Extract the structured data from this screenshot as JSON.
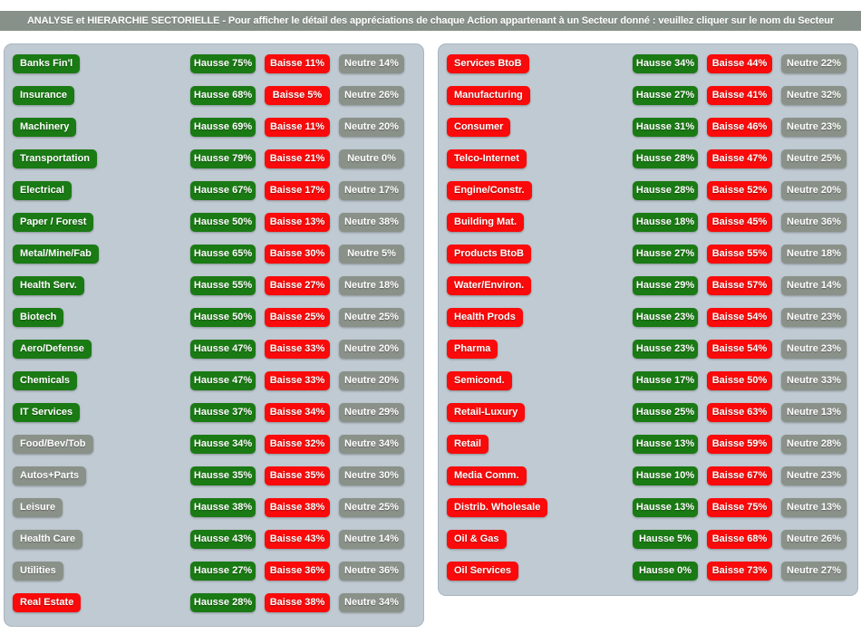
{
  "header": {
    "title": "ANALYSE et HIERARCHIE SECTORIELLE - Pour afficher le détail des appréciations de chaque Action appartenant à un Secteur donné : veuillez cliquer sur le nom du Secteur"
  },
  "legend": {
    "hausse_word": "Hausse",
    "baisse_word": "Baisse",
    "neutre_word": "Neutre"
  },
  "colors": {
    "green": "#1a7a14",
    "red": "#fa0a0a",
    "grey": "#8a9189",
    "panel_bg": "#c0cad2",
    "header_bg": "#879189",
    "page_bg": "#ffffff"
  },
  "chart_data": {
    "type": "table",
    "title": "ANALYSE et HIERARCHIE SECTORIELLE",
    "columns": [
      "Secteur",
      "Hausse",
      "Baisse",
      "Neutre"
    ],
    "units": "%",
    "left_column": [
      {
        "sector": "Banks Fin'l",
        "tone": "green",
        "hausse": 75,
        "baisse": 11,
        "neutre": 14
      },
      {
        "sector": "Insurance",
        "tone": "green",
        "hausse": 68,
        "baisse": 5,
        "neutre": 26
      },
      {
        "sector": "Machinery",
        "tone": "green",
        "hausse": 69,
        "baisse": 11,
        "neutre": 20
      },
      {
        "sector": "Transportation",
        "tone": "green",
        "hausse": 79,
        "baisse": 21,
        "neutre": 0
      },
      {
        "sector": "Electrical",
        "tone": "green",
        "hausse": 67,
        "baisse": 17,
        "neutre": 17
      },
      {
        "sector": "Paper / Forest",
        "tone": "green",
        "hausse": 50,
        "baisse": 13,
        "neutre": 38
      },
      {
        "sector": "Metal/Mine/Fab",
        "tone": "green",
        "hausse": 65,
        "baisse": 30,
        "neutre": 5
      },
      {
        "sector": "Health Serv.",
        "tone": "green",
        "hausse": 55,
        "baisse": 27,
        "neutre": 18
      },
      {
        "sector": "Biotech",
        "tone": "green",
        "hausse": 50,
        "baisse": 25,
        "neutre": 25
      },
      {
        "sector": "Aero/Defense",
        "tone": "green",
        "hausse": 47,
        "baisse": 33,
        "neutre": 20
      },
      {
        "sector": "Chemicals",
        "tone": "green",
        "hausse": 47,
        "baisse": 33,
        "neutre": 20
      },
      {
        "sector": "IT Services",
        "tone": "green",
        "hausse": 37,
        "baisse": 34,
        "neutre": 29
      },
      {
        "sector": "Food/Bev/Tob",
        "tone": "grey",
        "hausse": 34,
        "baisse": 32,
        "neutre": 34
      },
      {
        "sector": "Autos+Parts",
        "tone": "grey",
        "hausse": 35,
        "baisse": 35,
        "neutre": 30
      },
      {
        "sector": "Leisure",
        "tone": "grey",
        "hausse": 38,
        "baisse": 38,
        "neutre": 25
      },
      {
        "sector": "Health Care",
        "tone": "grey",
        "hausse": 43,
        "baisse": 43,
        "neutre": 14
      },
      {
        "sector": "Utilities",
        "tone": "grey",
        "hausse": 27,
        "baisse": 36,
        "neutre": 36
      },
      {
        "sector": "Real Estate",
        "tone": "red",
        "hausse": 28,
        "baisse": 38,
        "neutre": 34
      }
    ],
    "right_column": [
      {
        "sector": "Services BtoB",
        "tone": "red",
        "hausse": 34,
        "baisse": 44,
        "neutre": 22
      },
      {
        "sector": "Manufacturing",
        "tone": "red",
        "hausse": 27,
        "baisse": 41,
        "neutre": 32
      },
      {
        "sector": "Consumer",
        "tone": "red",
        "hausse": 31,
        "baisse": 46,
        "neutre": 23
      },
      {
        "sector": "Telco-Internet",
        "tone": "red",
        "hausse": 28,
        "baisse": 47,
        "neutre": 25
      },
      {
        "sector": "Engine/Constr.",
        "tone": "red",
        "hausse": 28,
        "baisse": 52,
        "neutre": 20
      },
      {
        "sector": "Building Mat.",
        "tone": "red",
        "hausse": 18,
        "baisse": 45,
        "neutre": 36
      },
      {
        "sector": "Products BtoB",
        "tone": "red",
        "hausse": 27,
        "baisse": 55,
        "neutre": 18
      },
      {
        "sector": "Water/Environ.",
        "tone": "red",
        "hausse": 29,
        "baisse": 57,
        "neutre": 14
      },
      {
        "sector": "Health Prods",
        "tone": "red",
        "hausse": 23,
        "baisse": 54,
        "neutre": 23
      },
      {
        "sector": "Pharma",
        "tone": "red",
        "hausse": 23,
        "baisse": 54,
        "neutre": 23
      },
      {
        "sector": "Semicond.",
        "tone": "red",
        "hausse": 17,
        "baisse": 50,
        "neutre": 33
      },
      {
        "sector": "Retail-Luxury",
        "tone": "red",
        "hausse": 25,
        "baisse": 63,
        "neutre": 13
      },
      {
        "sector": "Retail",
        "tone": "red",
        "hausse": 13,
        "baisse": 59,
        "neutre": 28
      },
      {
        "sector": "Media Comm.",
        "tone": "red",
        "hausse": 10,
        "baisse": 67,
        "neutre": 23
      },
      {
        "sector": "Distrib. Wholesale",
        "tone": "red",
        "hausse": 13,
        "baisse": 75,
        "neutre": 13
      },
      {
        "sector": "Oil & Gas",
        "tone": "red",
        "hausse": 5,
        "baisse": 68,
        "neutre": 26
      },
      {
        "sector": "Oil Services",
        "tone": "red",
        "hausse": 0,
        "baisse": 73,
        "neutre": 27
      }
    ]
  }
}
